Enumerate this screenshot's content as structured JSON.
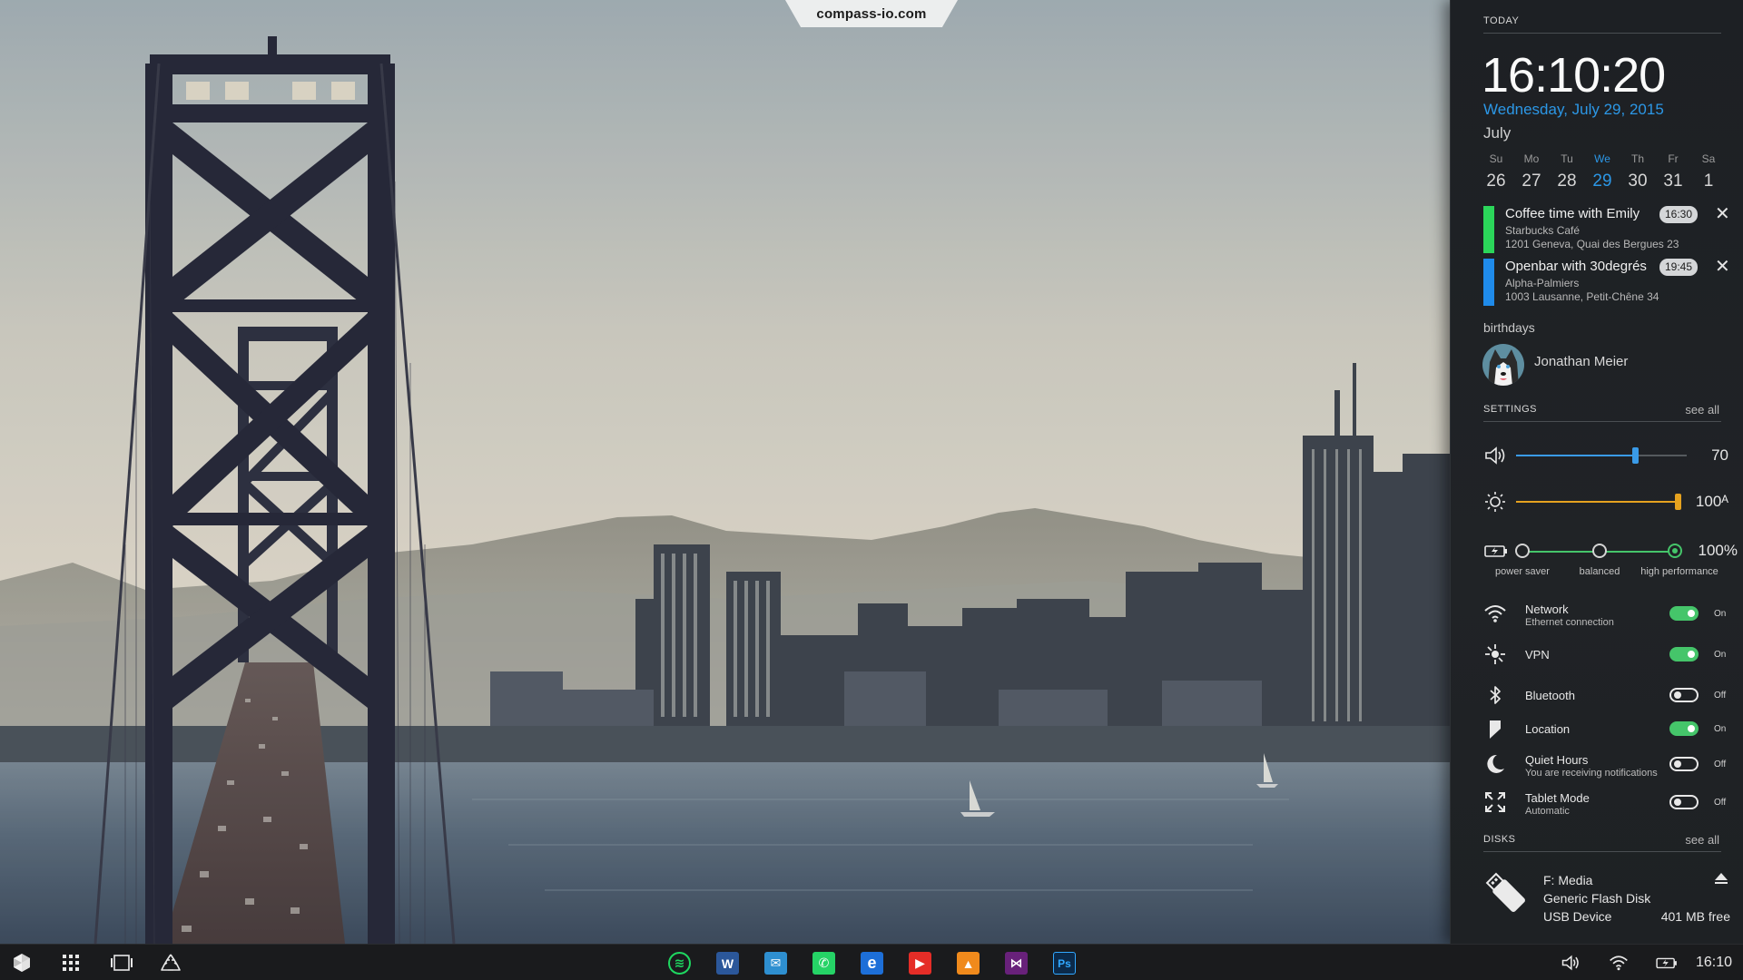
{
  "badge": {
    "text": "compass-io.com"
  },
  "panel": {
    "today_label": "TODAY",
    "time": "16:10:20",
    "date": "Wednesday, July 29, 2015",
    "month": "July",
    "week": [
      {
        "dow": "Su",
        "day": "26"
      },
      {
        "dow": "Mo",
        "day": "27"
      },
      {
        "dow": "Tu",
        "day": "28"
      },
      {
        "dow": "We",
        "day": "29",
        "today": true
      },
      {
        "dow": "Th",
        "day": "30"
      },
      {
        "dow": "Fr",
        "day": "31"
      },
      {
        "dow": "Sa",
        "day": "1"
      }
    ],
    "events": [
      {
        "title": "Coffee time with Emily",
        "place": "Starbucks Café",
        "address": "1201 Geneva, Quai des Bergues 23",
        "time": "16:30",
        "color": "#2bd65a",
        "close": "✕"
      },
      {
        "title": "Openbar with 30degrés",
        "place": "Alpha-Palmiers",
        "address": "1003 Lausanne, Petit-Chêne 34",
        "time": "19:45",
        "color": "#1f8bea",
        "close": "✕"
      }
    ],
    "birthdays_label": "birthdays",
    "birthday_person": "Jonathan Meier",
    "settings": {
      "label": "SETTINGS",
      "see_all": "see all",
      "volume": {
        "value": "70",
        "level": 0.7,
        "color": "#3a9be8",
        "icon": "speaker-icon"
      },
      "brightness": {
        "value": "100ᴬ",
        "level": 1.0,
        "color": "#e5a21f",
        "icon": "sun-icon"
      },
      "power": {
        "value": "100%",
        "icon": "battery-icon",
        "modes": [
          "power saver",
          "balanced",
          "high performance"
        ],
        "active": 2,
        "color": "#45c56a"
      },
      "toggles": [
        {
          "key": "network",
          "name": "Network",
          "sub": "Ethernet connection",
          "state": "On",
          "on": true,
          "icon": "wifi-icon"
        },
        {
          "key": "vpn",
          "name": "VPN",
          "sub": "",
          "state": "On",
          "on": true,
          "icon": "vpn-icon"
        },
        {
          "key": "bluetooth",
          "name": "Bluetooth",
          "sub": "",
          "state": "Off",
          "on": false,
          "icon": "bluetooth-icon"
        },
        {
          "key": "location",
          "name": "Location",
          "sub": "",
          "state": "On",
          "on": true,
          "icon": "location-icon"
        },
        {
          "key": "quiet-hours",
          "name": "Quiet Hours",
          "sub": "You are receiving notifications",
          "state": "Off",
          "on": false,
          "icon": "moon-icon"
        },
        {
          "key": "tablet-mode",
          "name": "Tablet Mode",
          "sub": "Automatic",
          "state": "Off",
          "on": false,
          "icon": "expand-icon"
        }
      ]
    },
    "disks": {
      "label": "DISKS",
      "see_all": "see all",
      "items": [
        {
          "name": "F: Media",
          "model": "Generic Flash Disk",
          "type": "USB Device",
          "free": "401 MB free",
          "icon": "usb-drive-icon"
        }
      ]
    }
  },
  "taskbar": {
    "left_buttons": [
      "start-icon",
      "apps-grid-icon",
      "task-view-icon",
      "recycle-bin-icon"
    ],
    "apps": [
      {
        "name": "spotify",
        "glyph": "≋",
        "bg": "#1a1b1d",
        "fg": "#1ed760"
      },
      {
        "name": "word",
        "glyph": "W",
        "bg": "#2b579a",
        "fg": "#ffffff"
      },
      {
        "name": "mail",
        "glyph": "✉",
        "bg": "#2e8fd0",
        "fg": "#ffffff"
      },
      {
        "name": "whatsapp",
        "glyph": "✆",
        "bg": "#25d366",
        "fg": "#ffffff"
      },
      {
        "name": "edge",
        "glyph": "e",
        "bg": "#1d6fd8",
        "fg": "#ffffff"
      },
      {
        "name": "youtube",
        "glyph": "▶",
        "bg": "#e52d27",
        "fg": "#ffffff"
      },
      {
        "name": "vlc",
        "glyph": "▲",
        "bg": "#f08a1c",
        "fg": "#ffffff"
      },
      {
        "name": "visual-studio",
        "glyph": "⋈",
        "bg": "#68217a",
        "fg": "#ffffff"
      },
      {
        "name": "photoshop",
        "glyph": "Ps",
        "bg": "#0b2a4a",
        "fg": "#31a8ff"
      }
    ],
    "tray": [
      "speaker-icon",
      "wifi-icon",
      "battery-icon"
    ],
    "clock": "16:10"
  }
}
